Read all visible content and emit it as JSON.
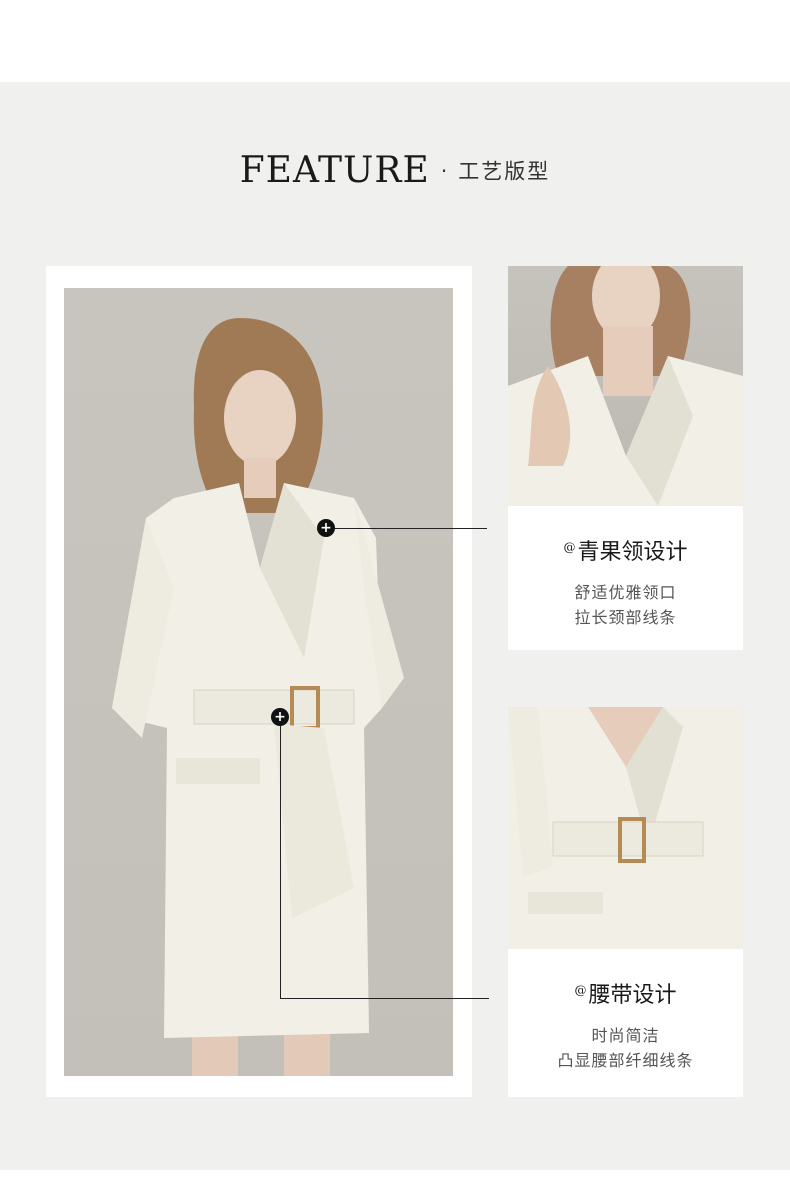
{
  "header": {
    "feature": "FEATURE",
    "separator": "·",
    "subtitle": "工艺版型"
  },
  "features": [
    {
      "at": "@",
      "title": "青果领设计",
      "lines": [
        "舒适优雅领口",
        "拉长颈部线条"
      ]
    },
    {
      "at": "@",
      "title": "腰带设计",
      "lines": [
        "时尚简洁",
        "凸显腰部纤细线条"
      ]
    }
  ],
  "markers": [
    "+",
    "+"
  ],
  "colors": {
    "background": "#f0f0ef",
    "card": "#ffffff",
    "dress": "#f2f0e6",
    "text": "#1a1a1a"
  }
}
